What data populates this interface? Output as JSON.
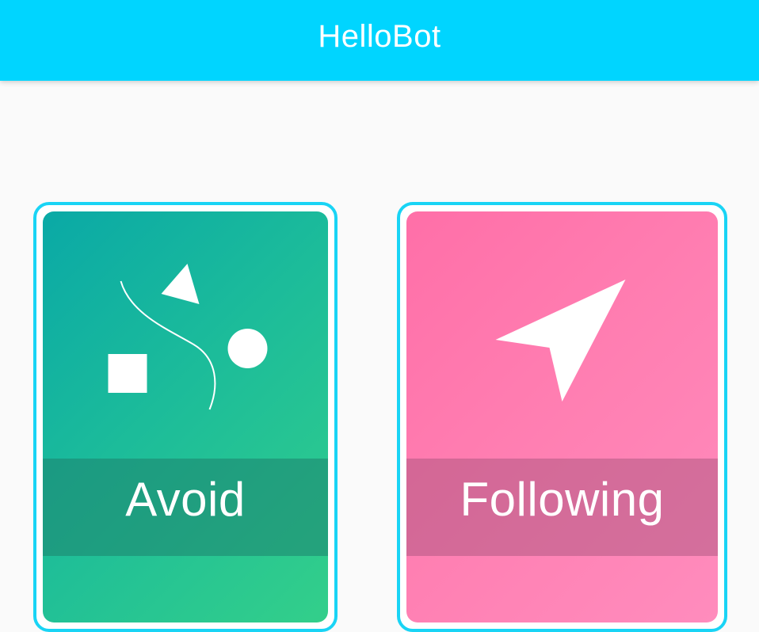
{
  "app": {
    "title": "HelloBot"
  },
  "colors": {
    "app_bar": "#00d5ff",
    "card_border": "#19d4f5",
    "avoid_card": "#1cbc9a",
    "following_card": "#ff7fb2",
    "background": "#fafafa"
  },
  "modes": [
    {
      "label": "Avoid",
      "icon": "obstacle-avoid-icon"
    },
    {
      "label": "Following",
      "icon": "navigation-arrow-icon"
    }
  ]
}
